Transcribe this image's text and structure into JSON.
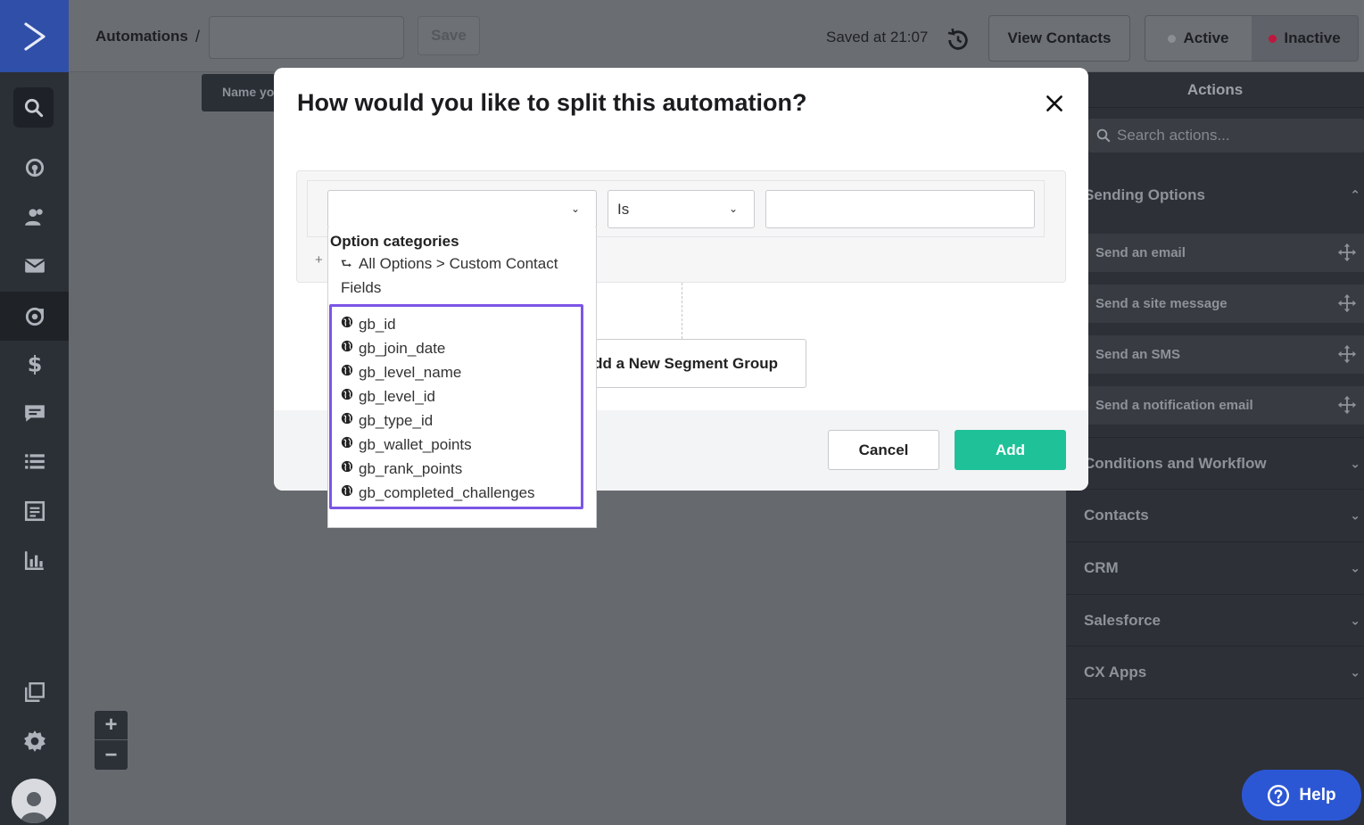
{
  "header": {
    "breadcrumb": "Automations",
    "separator": "/",
    "name_input_value": "",
    "save_label": "Save",
    "saved_status": "Saved at 21:07",
    "view_contacts_label": "View Contacts",
    "status_toggle": {
      "active_label": "Active",
      "inactive_label": "Inactive",
      "selected": "Inactive",
      "active_dot_color": "#8b8e93",
      "inactive_dot_color": "#c0173e"
    }
  },
  "nav": {
    "icons": [
      "logo-chevron-icon",
      "search-icon",
      "dashboard-icon",
      "contacts-icon",
      "campaigns-icon",
      "automations-icon",
      "deals-icon",
      "conversations-icon",
      "lists-icon",
      "forms-icon",
      "reports-icon",
      "apps-icon",
      "settings-icon",
      "user-avatar-icon"
    ],
    "active_item": "automations-icon"
  },
  "canvas": {
    "tooltip_text": "Name yo",
    "zoom_in": "+",
    "zoom_out": "−"
  },
  "actions_panel": {
    "title": "Actions",
    "search_placeholder": "Search actions...",
    "sections": [
      {
        "label": "Sending Options",
        "expanded": true
      },
      {
        "label": "Conditions and Workflow",
        "expanded": false
      },
      {
        "label": "Contacts",
        "expanded": false
      },
      {
        "label": "CRM",
        "expanded": false
      },
      {
        "label": "Salesforce",
        "expanded": false
      },
      {
        "label": "CX Apps",
        "expanded": false
      }
    ],
    "sending_items": [
      "Send an email",
      "Send a site message",
      "Send an SMS",
      "Send a notification email"
    ]
  },
  "modal": {
    "title": "How would you like to split this automation?",
    "field_select_value": "",
    "operator_value": "Is",
    "value_input": "",
    "add_condition_symbol": "+",
    "add_segment_group_label": "Add a New Segment Group",
    "add_segment_group_visible_text": "dd a New Segment Group",
    "cancel_label": "Cancel",
    "add_label": "Add",
    "add_color": "#1fc198"
  },
  "dropdown": {
    "heading": "Option categories",
    "back_path": "All Options > Custom Contact Fields",
    "highlight_color": "#7b55e6",
    "options": [
      "gb_id",
      "gb_join_date",
      "gb_level_name",
      "gb_level_id",
      "gb_type_id",
      "gb_wallet_points",
      "gb_rank_points",
      "gb_completed_challenges"
    ]
  },
  "help": {
    "label": "Help",
    "color": "#2c57d4"
  }
}
